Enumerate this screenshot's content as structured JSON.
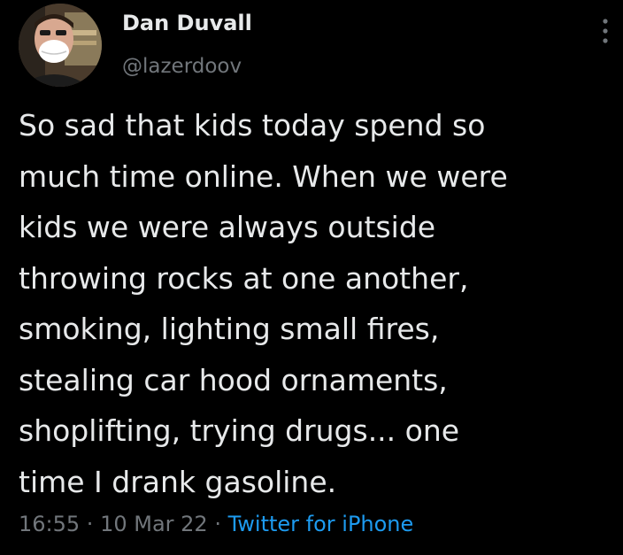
{
  "user": {
    "display_name": "Dan Duvall",
    "handle": "@lazerdoov",
    "avatar_icon": "avatar-photo"
  },
  "tweet": {
    "lines": [
      "So sad that kids today spend so",
      "much time online. When we were",
      "kids we were always outside",
      "throwing rocks at one another,",
      "smoking, lighting small fires,",
      "stealing car hood ornaments,",
      "shoplifting, trying drugs... one",
      "time I drank gasoline."
    ]
  },
  "meta": {
    "time": "16:55",
    "separator": " · ",
    "date": "10 Mar 22",
    "source": "Twitter for iPhone"
  },
  "more_icon": "vertical-ellipsis-icon",
  "colors": {
    "background": "#000000",
    "primary_text": "#e7e9ea",
    "secondary_text": "#71767b",
    "link": "#1d9bf0"
  }
}
